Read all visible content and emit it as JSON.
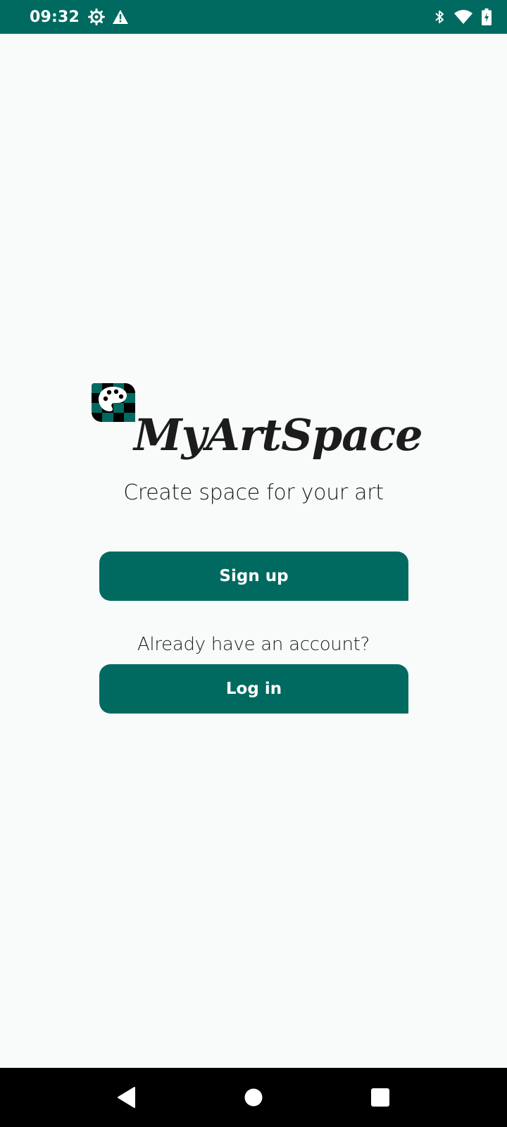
{
  "status_bar": {
    "time": "09:32",
    "left_icons": [
      "settings-gear-icon",
      "warning-icon"
    ],
    "right_icons": [
      "bluetooth-icon",
      "wifi-icon",
      "battery-charging-icon"
    ],
    "background_color": "#006a60"
  },
  "app": {
    "title": "MyArtSpace",
    "tagline": "Create space for your art",
    "logo_icon": "palette-icon",
    "accent_color": "#006a60"
  },
  "actions": {
    "signup_label": "Sign up",
    "account_prompt": "Already have an account?",
    "login_label": "Log in"
  },
  "nav_bar": {
    "buttons": [
      "back-icon",
      "home-icon",
      "recents-icon"
    ]
  }
}
